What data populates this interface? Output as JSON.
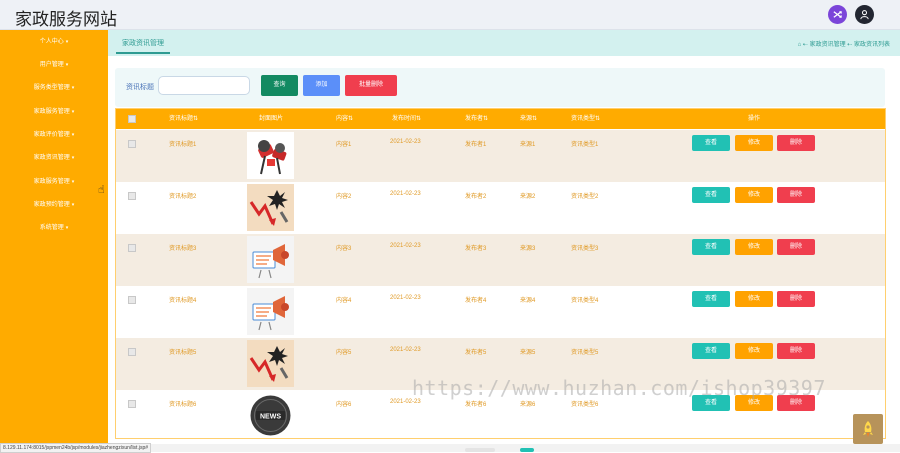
{
  "app": {
    "title": "家政服务网站",
    "colors": {
      "sidebar": "#ffab00",
      "teal": "#21c1b4",
      "orange": "#ffa200",
      "red": "#f03e4e",
      "green": "#138a62",
      "blue": "#5b8ff9",
      "purple": "#7b45d9",
      "dark": "#222631"
    },
    "topbar_icons": [
      "shuffle-icon",
      "user-icon"
    ]
  },
  "sidebar": {
    "items": [
      {
        "label": "个人中心"
      },
      {
        "label": "用户管理"
      },
      {
        "label": "服务类型管理"
      },
      {
        "label": "家政服务管理"
      },
      {
        "label": "家政评价管理"
      },
      {
        "label": "家政资讯管理"
      },
      {
        "label": "家政服务管理"
      },
      {
        "label": "家政预约管理"
      },
      {
        "label": "系统管理"
      }
    ]
  },
  "tabbar": {
    "active_tab": "家政资讯管理",
    "breadcrumb": [
      "家政资讯管理",
      "家政资讯列表"
    ]
  },
  "search": {
    "label": "资讯标题",
    "value": "",
    "buttons": {
      "query": "查询",
      "add": "添加",
      "batch_delete": "批量删除"
    }
  },
  "table": {
    "columns": [
      "资讯标题",
      "封面图片",
      "内容",
      "发布时间",
      "发布者",
      "来源",
      "资讯类型",
      "操作"
    ],
    "sort_mark": "⇅",
    "row_actions": {
      "view": "查看",
      "edit": "修改",
      "delete": "删除"
    },
    "rows": [
      {
        "title": "资讯标题1",
        "image": "microphone-image",
        "content": "内容1",
        "date": "2021-02-23",
        "publisher": "发布者1",
        "source": "来源1",
        "type": "资讯类型1"
      },
      {
        "title": "资讯标题2",
        "image": "declining-chart-image",
        "content": "内容2",
        "date": "2021-02-23",
        "publisher": "发布者2",
        "source": "来源2",
        "type": "资讯类型2"
      },
      {
        "title": "资讯标题3",
        "image": "megaphone-image",
        "content": "内容3",
        "date": "2021-02-23",
        "publisher": "发布者3",
        "source": "来源3",
        "type": "资讯类型3"
      },
      {
        "title": "资讯标题4",
        "image": "megaphone-image",
        "content": "内容4",
        "date": "2021-02-23",
        "publisher": "发布者4",
        "source": "来源4",
        "type": "资讯类型4"
      },
      {
        "title": "资讯标题5",
        "image": "declining-chart-image",
        "content": "内容5",
        "date": "2021-02-23",
        "publisher": "发布者5",
        "source": "来源5",
        "type": "资讯类型5"
      },
      {
        "title": "资讯标题6",
        "image": "news-badge-image",
        "content": "内容6",
        "date": "2021-02-23",
        "publisher": "发布者6",
        "source": "来源6",
        "type": "资讯类型6"
      }
    ]
  },
  "news_badge_text": "NEWS",
  "watermark": "https://www.huzhan.com/ishop39397",
  "statusbar": {
    "url": "8.129.11.174:8015/jspmen24b/jsp/modules/jiazhengzixun/list.jsp#"
  }
}
